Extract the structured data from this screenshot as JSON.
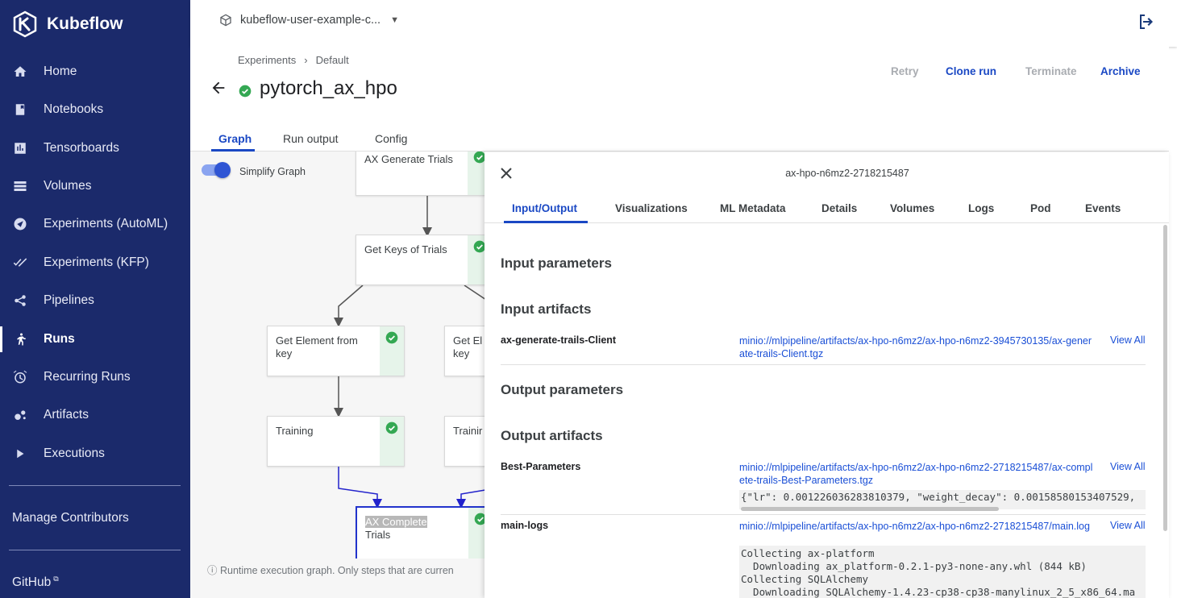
{
  "sidebar": {
    "brand": "Kubeflow",
    "items": [
      {
        "label": "Home",
        "icon": "home-icon"
      },
      {
        "label": "Notebooks",
        "icon": "notebook-icon"
      },
      {
        "label": "Tensorboards",
        "icon": "chart-icon"
      },
      {
        "label": "Volumes",
        "icon": "storage-icon"
      },
      {
        "label": "Experiments (AutoML)",
        "icon": "automl-icon"
      },
      {
        "label": "Experiments (KFP)",
        "icon": "check-icon"
      },
      {
        "label": "Pipelines",
        "icon": "pipeline-icon"
      },
      {
        "label": "Runs",
        "icon": "run-icon",
        "active": true
      },
      {
        "label": "Recurring Runs",
        "icon": "alarm-icon"
      },
      {
        "label": "Artifacts",
        "icon": "artifact-icon"
      },
      {
        "label": "Executions",
        "icon": "play-icon"
      }
    ],
    "manage_contributors": "Manage Contributors",
    "github": "GitHub"
  },
  "topbar": {
    "namespace": "kubeflow-user-example-c..."
  },
  "breadcrumb": {
    "parent": "Experiments",
    "sep": "›",
    "current": "Default"
  },
  "run": {
    "title": "pytorch_ax_hpo",
    "actions": {
      "retry": "Retry",
      "clone": "Clone run",
      "terminate": "Terminate",
      "archive": "Archive"
    }
  },
  "tabs": {
    "graph": "Graph",
    "run_output": "Run output",
    "config": "Config"
  },
  "graph": {
    "simplify_label": "Simplify Graph",
    "nodes": {
      "ax_generate": "AX Generate Trials",
      "get_keys": "Get Keys of Trials",
      "get_element_1": "Get Element from key",
      "get_element_2": "Get El key",
      "training_1": "Training",
      "training_2": "Trainir",
      "ax_complete_1": "AX Complete",
      "ax_complete_2": "Trials"
    },
    "footnote": "Runtime execution graph. Only steps that are curren"
  },
  "panel": {
    "title": "ax-hpo-n6mz2-2718215487",
    "tabs": {
      "io": "Input/Output",
      "viz": "Visualizations",
      "mlmd": "ML Metadata",
      "details": "Details",
      "volumes": "Volumes",
      "logs": "Logs",
      "pod": "Pod",
      "events": "Events"
    },
    "input_parameters": "Input parameters",
    "input_artifacts": "Input artifacts",
    "output_parameters": "Output parameters",
    "output_artifacts": "Output artifacts",
    "view_all": "View All",
    "in_art": {
      "name": "ax-generate-trails-Client",
      "link": "minio://mlpipeline/artifacts/ax-hpo-n6mz2/ax-hpo-n6mz2-3945730135/ax-generate-trails-Client.tgz"
    },
    "out_art1": {
      "name": "Best-Parameters",
      "link": "minio://mlpipeline/artifacts/ax-hpo-n6mz2/ax-hpo-n6mz2-2718215487/ax-complete-trails-Best-Parameters.tgz",
      "preview": "{\"lr\": 0.001226036283810379, \"weight_decay\": 0.0015858015340752​9,"
    },
    "out_art2": {
      "name": "main-logs",
      "link": "minio://mlpipeline/artifacts/ax-hpo-n6mz2/ax-hpo-n6mz2-2718215487/main.log",
      "preview": "Collecting ax-platform\n  Downloading ax_platform-0.2.1-py3-none-any.whl (844 kB)\nCollecting SQLAlchemy\n  Downloading SQLAlchemy-1.4.23-cp38-cp38-manylinux_2_5_x86_64.ma"
    }
  }
}
